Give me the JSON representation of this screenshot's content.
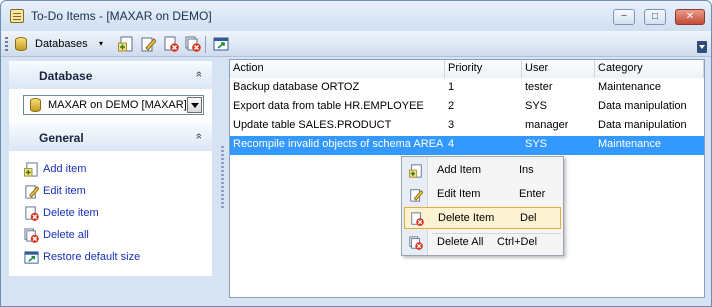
{
  "window": {
    "title": "To-Do Items - [MAXAR on DEMO]",
    "buttons": {
      "minimize": "−",
      "maximize": "□",
      "close": "✕"
    }
  },
  "toolbar": {
    "databases_label": "Databases",
    "databases_caret": "▾",
    "buttons": [
      "add-item-icon",
      "edit-item-icon",
      "delete-item-icon",
      "delete-all-icon",
      "restore-size-icon"
    ]
  },
  "sidebar": {
    "database_section": {
      "title": "Database",
      "chevron": "»",
      "selected_db": "MAXAR on DEMO [MAXAR]"
    },
    "general_section": {
      "title": "General",
      "chevron": "»",
      "items": [
        {
          "label": "Add item",
          "icon": "add-item-icon"
        },
        {
          "label": "Edit item",
          "icon": "edit-item-icon"
        },
        {
          "label": "Delete item",
          "icon": "delete-item-icon"
        },
        {
          "label": "Delete all",
          "icon": "delete-all-icon"
        },
        {
          "label": "Restore default size",
          "icon": "restore-size-icon"
        }
      ]
    }
  },
  "grid": {
    "columns": [
      "Action",
      "Priority",
      "User",
      "Category"
    ],
    "rows": [
      {
        "action": "Backup database ORTOZ",
        "priority": "1",
        "user": "tester",
        "category": "Maintenance"
      },
      {
        "action": "Export data from table HR.EMPLOYEE",
        "priority": "2",
        "user": "SYS",
        "category": "Data manipulation"
      },
      {
        "action": "Update table SALES.PRODUCT",
        "priority": "3",
        "user": "manager",
        "category": "Data manipulation"
      },
      {
        "action": "Recompile invalid objects of schema AREA",
        "priority": "4",
        "user": "SYS",
        "category": "Maintenance",
        "selected": true
      }
    ]
  },
  "context_menu": {
    "items": [
      {
        "label": "Add Item",
        "shortcut": "Ins",
        "icon": "add-item-icon"
      },
      {
        "label": "Edit Item",
        "shortcut": "Enter",
        "icon": "edit-item-icon"
      },
      {
        "label": "Delete Item",
        "shortcut": "Del",
        "icon": "delete-item-icon",
        "highlighted": true
      },
      {
        "label": "Delete All",
        "shortcut": "Ctrl+Del",
        "icon": "delete-all-icon"
      }
    ]
  },
  "colors": {
    "selection": "#3399ff",
    "link": "#1731b9",
    "menu_highlight": "#fdf2d1"
  }
}
